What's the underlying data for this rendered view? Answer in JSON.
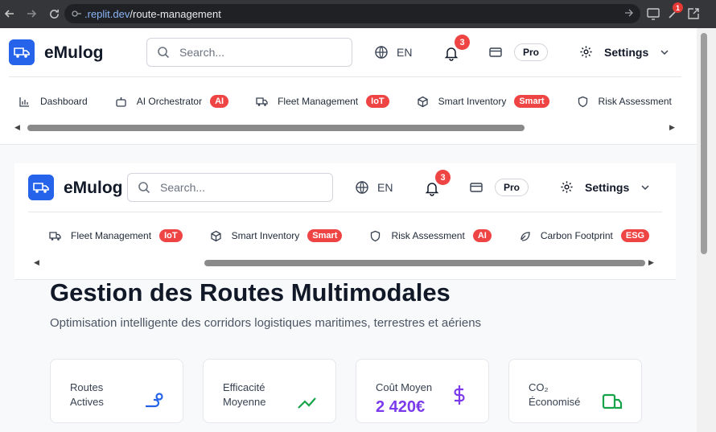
{
  "browser": {
    "url_host": ".replit.dev",
    "url_path": "/route-management",
    "extension_badge": "1"
  },
  "header": {
    "brand": "eMulog",
    "search_placeholder": "Search...",
    "language": "EN",
    "notifications_count": "3",
    "plan_badge": "Pro",
    "settings_label": "Settings"
  },
  "nav_primary": [
    {
      "label": "Dashboard",
      "icon": "chart-bar-icon",
      "badge": ""
    },
    {
      "label": "AI Orchestrator",
      "icon": "robot-icon",
      "badge": "AI"
    },
    {
      "label": "Fleet Management",
      "icon": "truck-icon",
      "badge": "IoT"
    },
    {
      "label": "Smart Inventory",
      "icon": "package-icon",
      "badge": "Smart"
    },
    {
      "label": "Risk Assessment",
      "icon": "shield-icon",
      "badge": ""
    }
  ],
  "nav_secondary": [
    {
      "label": "Fleet Management",
      "icon": "truck-icon",
      "badge": "IoT"
    },
    {
      "label": "Smart Inventory",
      "icon": "package-icon",
      "badge": "Smart"
    },
    {
      "label": "Risk Assessment",
      "icon": "shield-icon",
      "badge": "AI"
    },
    {
      "label": "Carbon Footprint",
      "icon": "leaf-icon",
      "badge": "ESG"
    }
  ],
  "page": {
    "title": "Gestion des Routes Multimodales",
    "subtitle": "Optimisation intelligente des corridors logistiques maritimes, terrestres et aériens"
  },
  "stats": [
    {
      "label": "Routes Actives",
      "icon": "route-icon",
      "color": "#2563eb",
      "value": ""
    },
    {
      "label": "Efficacité Moyenne",
      "icon": "trend-icon",
      "color": "#16a34a",
      "value": ""
    },
    {
      "label": "Coût Moyen",
      "icon": "dollar-icon",
      "color": "#7c3aed",
      "value": "2 420€"
    },
    {
      "label": "CO₂ Économisé",
      "icon": "leaf-box-icon",
      "color": "#16a34a",
      "value": ""
    }
  ],
  "colors": {
    "accent": "#2563eb",
    "badge": "#ef4444"
  }
}
